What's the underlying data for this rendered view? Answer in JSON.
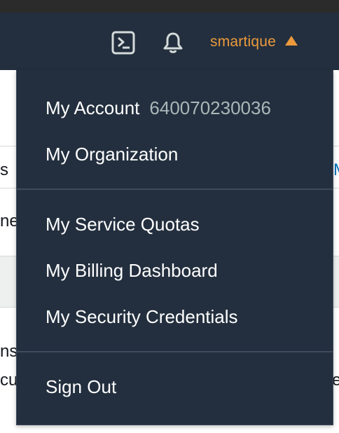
{
  "navbar": {
    "account_name": "smartique",
    "icons": [
      "terminal-icon",
      "bell-icon",
      "caret-up-icon"
    ],
    "accent_color": "#ec9a3c",
    "background_color": "#232f3e"
  },
  "background": {
    "fragments": [
      "s",
      "ne",
      "ns",
      "cu",
      "e"
    ],
    "link_fragment": "M"
  },
  "account_menu": {
    "my_account_label": "My Account",
    "account_id": "640070230036",
    "my_organization_label": "My Organization",
    "service_quotas_label": "My Service Quotas",
    "billing_dashboard_label": "My Billing Dashboard",
    "security_credentials_label": "My Security Credentials",
    "sign_out_label": "Sign Out"
  }
}
